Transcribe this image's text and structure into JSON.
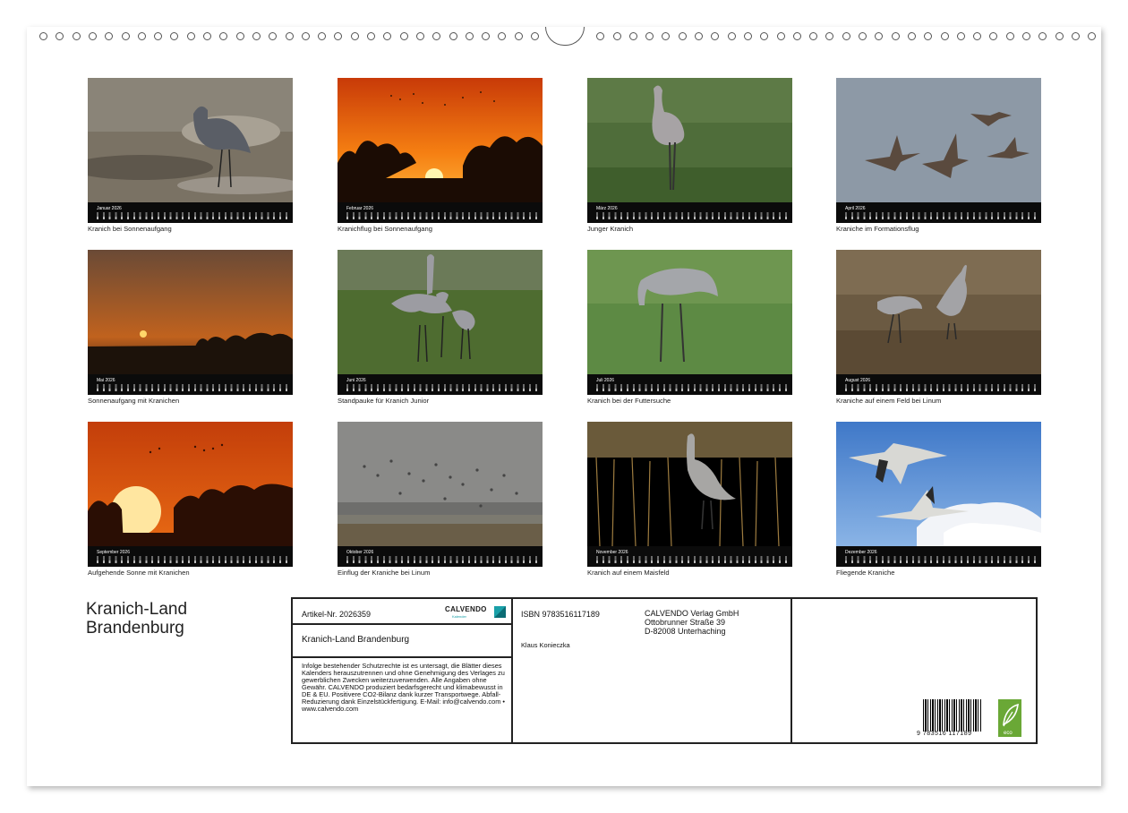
{
  "months": [
    {
      "name": "Januar 2026",
      "caption": "Kranich bei Sonnenaufgang"
    },
    {
      "name": "Februar 2026",
      "caption": "Kranichflug bei Sonnenaufgang"
    },
    {
      "name": "März 2026",
      "caption": "Junger Kranich"
    },
    {
      "name": "April 2026",
      "caption": "Kraniche im Formationsflug"
    },
    {
      "name": "Mai 2026",
      "caption": "Sonnenaufgang mit Kranichen"
    },
    {
      "name": "Juni 2026",
      "caption": "Standpauke für Kranich Junior"
    },
    {
      "name": "Juli 2026",
      "caption": "Kranich bei der Futtersuche"
    },
    {
      "name": "August 2026",
      "caption": "Kraniche auf einem Feld bei Linum"
    },
    {
      "name": "September 2026",
      "caption": "Aufgehende Sonne mit Kranichen"
    },
    {
      "name": "Oktober 2026",
      "caption": "Einflug der Kraniche bei Linum"
    },
    {
      "name": "November 2026",
      "caption": "Kranich auf einem Maisfeld"
    },
    {
      "name": "Dezember 2026",
      "caption": "Fliegende Kraniche"
    }
  ],
  "title_line1": "Kranich-Land",
  "title_line2": "Brandenburg",
  "info": {
    "article": "Artikel-Nr. 2026359",
    "logo_text": "CALVENDO",
    "logo_sub": "Kalender",
    "product_title": "Kranich-Land Brandenburg",
    "legal": "Infolge bestehender Schutzrechte ist es untersagt, die Blätter dieses Kalenders herauszutrennen und ohne Genehmigung des Verlages zu gewerblichen Zwecken weiterzuverwenden. Alle Angaben ohne Gewähr. CALVENDO produziert bedarfsgerecht und klimabewusst in DE & EU. Positivere CO2-Bilanz dank kurzer Transportwege. Abfall-Reduzierung dank Einzelstückfertigung. E-Mail: info@calvendo.com • www.calvendo.com",
    "isbn": "ISBN 9783516117189",
    "author": "Klaus Konieczka",
    "publisher_name": "CALVENDO Verlag GmbH",
    "publisher_street": "Ottobrunner Straße 39",
    "publisher_city": "D-82008 Unterhaching",
    "barcode_number": "9 783516 117189",
    "eco_label": "eco"
  },
  "colors": {
    "accent": "#1aa0a8",
    "eco_green": "#6aa836"
  }
}
